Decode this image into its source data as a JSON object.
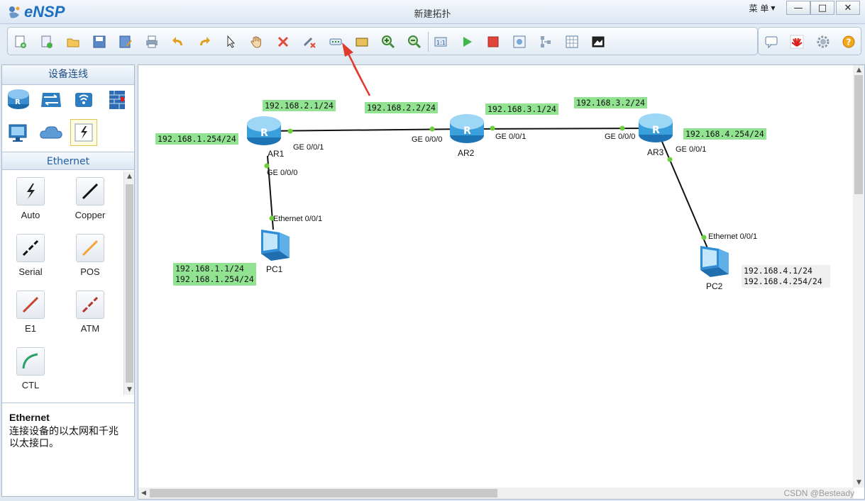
{
  "app": {
    "name": "eNSP",
    "window_title": "新建拓扑",
    "menu_label": "菜 单"
  },
  "window_controls": {
    "minimize": "—",
    "maximize": "□",
    "close": "✕"
  },
  "toolbar": {
    "icons": [
      "new-topology-icon",
      "new-example-icon",
      "open-icon",
      "save-icon",
      "save-as-icon",
      "print-icon",
      "undo-icon",
      "redo-icon",
      "select-pointer-icon",
      "pan-hand-icon",
      "delete-icon",
      "delete-connection-icon",
      "text-label-icon",
      "rectangle-icon",
      "zoom-in-icon",
      "zoom-out-icon",
      "fit-window-icon",
      "start-device-icon",
      "stop-device-icon",
      "capture-icon",
      "topology-icon",
      "grid-icon",
      "snapshot-icon"
    ],
    "right_icons": [
      "chat-icon",
      "huawei-icon",
      "settings-icon",
      "help-icon"
    ]
  },
  "panel": {
    "title": "设备连线",
    "devices": [
      "router-icon",
      "switch-icon",
      "wireless-icon",
      "firewall-icon",
      "pc-icon",
      "cloud-icon",
      "connection-icon"
    ],
    "section": "Ethernet",
    "cables": [
      {
        "label": "Auto",
        "icon": "auto-cable-icon"
      },
      {
        "label": "Copper",
        "icon": "copper-cable-icon"
      },
      {
        "label": "Serial",
        "icon": "serial-cable-icon"
      },
      {
        "label": "POS",
        "icon": "pos-cable-icon"
      },
      {
        "label": "E1",
        "icon": "e1-cable-icon"
      },
      {
        "label": "ATM",
        "icon": "atm-cable-icon"
      },
      {
        "label": "CTL",
        "icon": "ctl-cable-icon"
      }
    ],
    "desc_title": "Ethernet",
    "desc_text": "连接设备的以太网和千兆以太接口。"
  },
  "topology": {
    "devices": {
      "ar1": "AR1",
      "ar2": "AR2",
      "ar3": "AR3",
      "pc1": "PC1",
      "pc2": "PC2"
    },
    "ports": {
      "ar1_ge001": "GE 0/0/1",
      "ar1_ge000": "GE 0/0/0",
      "pc1_eth": "Ethernet 0/0/1",
      "ar2_ge000": "GE 0/0/0",
      "ar2_ge001": "GE 0/0/1",
      "ar3_ge000": "GE 0/0/0",
      "ar3_ge001": "GE 0/0/1",
      "pc2_eth": "Ethernet 0/0/1"
    },
    "labels": {
      "ar1_left": "192.168.1.254/24",
      "ar1_top": "192.168.2.1/24",
      "ar2_left": "192.168.2.2/24",
      "ar2_right": "192.168.3.1/24",
      "ar3_left": "192.168.3.2/24",
      "ar3_right": "192.168.4.254/24",
      "pc1_ip": "192.168.1.1/24",
      "pc1_gw": "192.168.1.254/24",
      "pc2_ip": "192.168.4.1/24",
      "pc2_gw": "192.168.4.254/24"
    }
  },
  "watermark": "CSDN @Besteady",
  "colors": {
    "label_green": "#91e391",
    "link_dot": "#6bd13a",
    "router": "#3aa9e0",
    "annotation_arrow": "#e23a2e"
  }
}
